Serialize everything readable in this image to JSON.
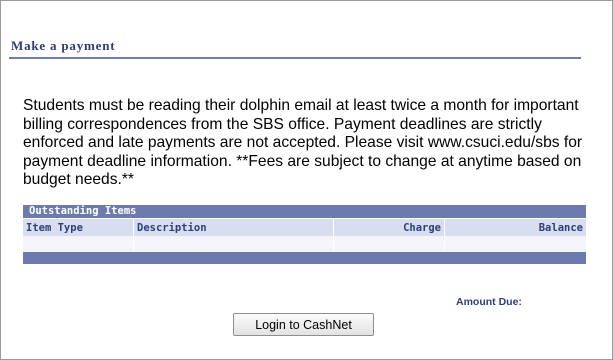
{
  "page": {
    "title": "Make a payment",
    "notice": "Students must be reading their dolphin email at least twice a month for important billing correspondences from the SBS office. Payment deadlines are strictly enforced and late payments are not accepted. Please visit www.csuci.edu/sbs for payment deadline information. **Fees are subject to change at anytime based on budget needs.**"
  },
  "table": {
    "caption": "Outstanding Items",
    "columns": [
      "Item Type",
      "Description",
      "Charge",
      "Balance"
    ],
    "rows": []
  },
  "summary": {
    "amount_due_label": "Amount Due:"
  },
  "actions": {
    "login_label": "Login to CashNet"
  },
  "colors": {
    "title": "#2d3e7a",
    "table_bar": "#6d7aad",
    "table_header": "#d6deef"
  }
}
